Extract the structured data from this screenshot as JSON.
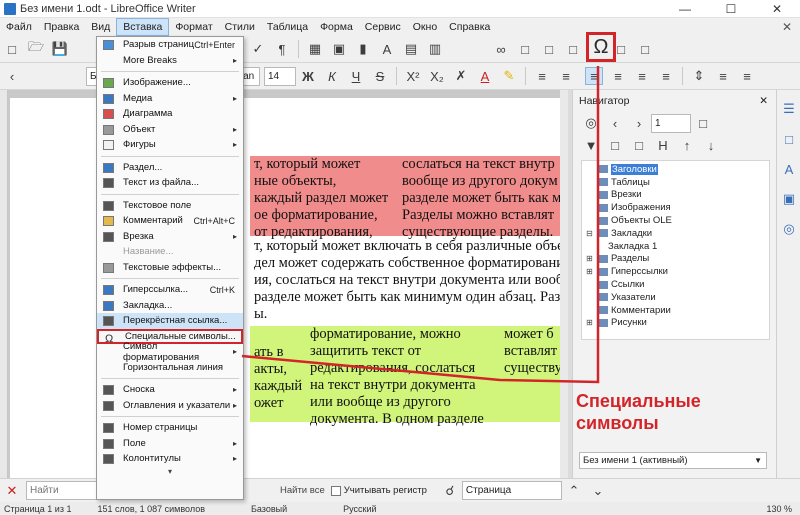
{
  "window": {
    "title": "Без имени 1.odt - LibreOffice Writer",
    "controls": [
      "—",
      "☐",
      "✕"
    ]
  },
  "menubar": {
    "items": [
      "Файл",
      "Правка",
      "Вид",
      "Вставка",
      "Формат",
      "Стили",
      "Таблица",
      "Форма",
      "Сервис",
      "Окно",
      "Справка"
    ],
    "active_index": 3,
    "close": "✕"
  },
  "toolbar2": {
    "style_combo": "Базовый",
    "font_name": "Roman",
    "font_size": "14",
    "bold": "Ж",
    "italic": "К",
    "underline": "Ч",
    "strike": "S",
    "superscript": "X²",
    "subscript": "X₂",
    "font_color": "A"
  },
  "insert_menu": {
    "items": [
      {
        "label": "Разрыв страниц",
        "shortcut": "Ctrl+Enter",
        "arrow": ""
      },
      {
        "label": "More Breaks",
        "shortcut": "",
        "arrow": "▸"
      },
      {
        "label": "Изображение...",
        "shortcut": "",
        "arrow": ""
      },
      {
        "label": "Медиа",
        "shortcut": "",
        "arrow": "▸"
      },
      {
        "label": "Диаграмма",
        "shortcut": "",
        "arrow": ""
      },
      {
        "label": "Объект",
        "shortcut": "",
        "arrow": "▸"
      },
      {
        "label": "Фигуры",
        "shortcut": "",
        "arrow": "▸"
      },
      {
        "label": "Раздел...",
        "shortcut": "",
        "arrow": ""
      },
      {
        "label": "Текст из файла...",
        "shortcut": "",
        "arrow": ""
      },
      {
        "label": "Текстовое поле",
        "shortcut": "",
        "arrow": ""
      },
      {
        "label": "Комментарий",
        "shortcut": "Ctrl+Alt+C",
        "arrow": ""
      },
      {
        "label": "Врезка",
        "shortcut": "",
        "arrow": "▸"
      },
      {
        "label": "Название...",
        "shortcut": "",
        "arrow": ""
      },
      {
        "label": "Текстовые эффекты...",
        "shortcut": "",
        "arrow": ""
      },
      {
        "label": "Гиперссылка...",
        "shortcut": "Ctrl+K",
        "arrow": ""
      },
      {
        "label": "Закладка...",
        "shortcut": "",
        "arrow": ""
      },
      {
        "label": "Перекрёстная ссылка...",
        "shortcut": "",
        "arrow": ""
      },
      {
        "label": "Специальные символы...",
        "shortcut": "",
        "arrow": ""
      },
      {
        "label": "Символ форматирования",
        "shortcut": "",
        "arrow": "▸"
      },
      {
        "label": "Горизонтальная линия",
        "shortcut": "",
        "arrow": ""
      },
      {
        "label": "Сноска",
        "shortcut": "",
        "arrow": "▸"
      },
      {
        "label": "Оглавления и указатели",
        "shortcut": "",
        "arrow": "▸"
      },
      {
        "label": "Номер страницы",
        "shortcut": "",
        "arrow": ""
      },
      {
        "label": "Поле",
        "shortcut": "",
        "arrow": "▸"
      },
      {
        "label": "Колонтитулы",
        "shortcut": "",
        "arrow": "▸"
      }
    ],
    "more": "▾"
  },
  "document": {
    "red_left": [
      "т, который может",
      "ные объекты,",
      "каждый раздел может",
      "ое форматирование,",
      "от редактирования,"
    ],
    "red_right": [
      "сослаться на текст внутр",
      "вообще из другого докум",
      "разделе может быть как м",
      "Разделы можно вставлят",
      "существующие разделы."
    ],
    "para": [
      "т, который может включать в себя различные объект",
      "дел может содержать собственное форматирование",
      "ия, сослаться на текст внутри документа или вообщ",
      "разделе может быть как минимум один абзац. Раздел",
      "ы."
    ],
    "green_left": [
      "ать в",
      "акты,",
      "каждый",
      "ожет"
    ],
    "green_mid": [
      "форматирование, можно",
      "защитить текст от",
      "редактирования, сослаться",
      "на текст внутри документа",
      "или вообще из другого",
      "документа. В одном разделе"
    ],
    "green_right": [
      "может б",
      "вставлят",
      "существу"
    ]
  },
  "navigator": {
    "title": "Навигатор",
    "page_number": "1",
    "items": [
      {
        "label": "Заголовки",
        "expander": "",
        "selected": true
      },
      {
        "label": "Таблицы",
        "expander": "",
        "selected": false
      },
      {
        "label": "Врезки",
        "expander": "",
        "selected": false
      },
      {
        "label": "Изображения",
        "expander": "",
        "selected": false
      },
      {
        "label": "Объекты OLE",
        "expander": "",
        "selected": false
      },
      {
        "label": "Закладки",
        "expander": "⊟",
        "selected": false
      },
      {
        "label": "Закладка 1",
        "expander": "",
        "selected": false
      },
      {
        "label": "Разделы",
        "expander": "⊞",
        "selected": false
      },
      {
        "label": "Гиперссылки",
        "expander": "⊞",
        "selected": false
      },
      {
        "label": "Ссылки",
        "expander": "",
        "selected": false
      },
      {
        "label": "Указатели",
        "expander": "",
        "selected": false
      },
      {
        "label": "Комментарии",
        "expander": "",
        "selected": false
      },
      {
        "label": "Рисунки",
        "expander": "⊞",
        "selected": false
      }
    ],
    "document_select": "Без имени 1 (активный)"
  },
  "annotation": {
    "line1": "Специальные",
    "line2": "символы",
    "color": "#d2252a"
  },
  "findbar": {
    "placeholder": "Найти",
    "find_all": "Найти все",
    "match_case": "Учитывать регистр",
    "scope": "Страница"
  },
  "statusbar": {
    "page": "Страница 1 из 1",
    "words": "151 слов, 1 087 символов",
    "style": "Базовый",
    "language": "Русский",
    "zoom": "130 %"
  }
}
